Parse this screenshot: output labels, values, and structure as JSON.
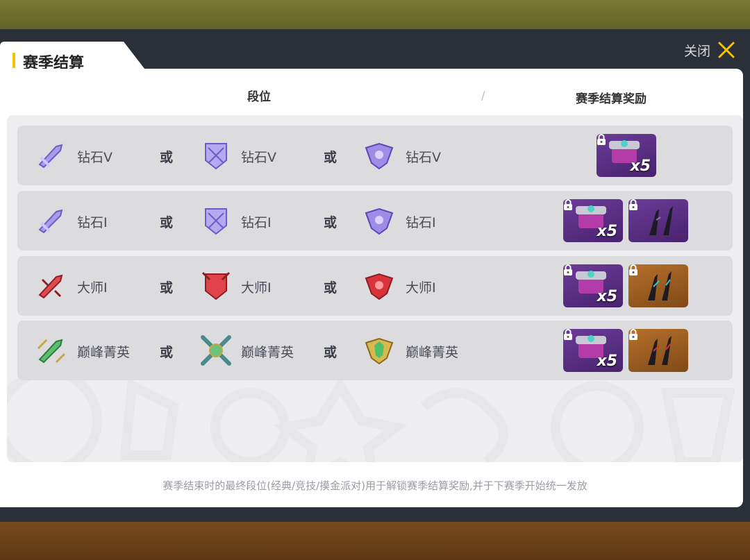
{
  "window": {
    "title": "赛季结算",
    "close_label": "关闭"
  },
  "columns": {
    "rank": "段位",
    "separator": "/",
    "reward": "赛季结算奖励"
  },
  "or_text": "或",
  "rows": [
    {
      "tier": "diamond",
      "ranks": [
        "钻石V",
        "钻石V",
        "钻石V"
      ],
      "rewards": [
        {
          "type": "chest",
          "quantity": "x5",
          "locked": true
        }
      ]
    },
    {
      "tier": "diamond",
      "ranks": [
        "钻石I",
        "钻石I",
        "钻石I"
      ],
      "rewards": [
        {
          "type": "chest",
          "quantity": "x5",
          "locked": true
        },
        {
          "type": "claw",
          "locked": true
        }
      ]
    },
    {
      "tier": "master",
      "ranks": [
        "大师I",
        "大师I",
        "大师I"
      ],
      "rewards": [
        {
          "type": "chest",
          "quantity": "x5",
          "locked": true
        },
        {
          "type": "claw",
          "locked": true
        }
      ]
    },
    {
      "tier": "elite",
      "ranks": [
        "巅峰菁英",
        "巅峰菁英",
        "巅峰菁英"
      ],
      "rewards": [
        {
          "type": "chest",
          "quantity": "x5",
          "locked": true
        },
        {
          "type": "claw",
          "locked": true
        }
      ]
    }
  ],
  "footer": "赛季结束时的最终段位(经典/竞技/摸金派对)用于解锁赛季结算奖励,并于下赛季开始统一发放",
  "colors": {
    "accent": "#f5c400",
    "diamond": "#8f7ad8",
    "master": "#d8323a",
    "elite": "#3fa85a",
    "reward_purple": "#6a2f98",
    "reward_orange": "#9a5a20"
  }
}
